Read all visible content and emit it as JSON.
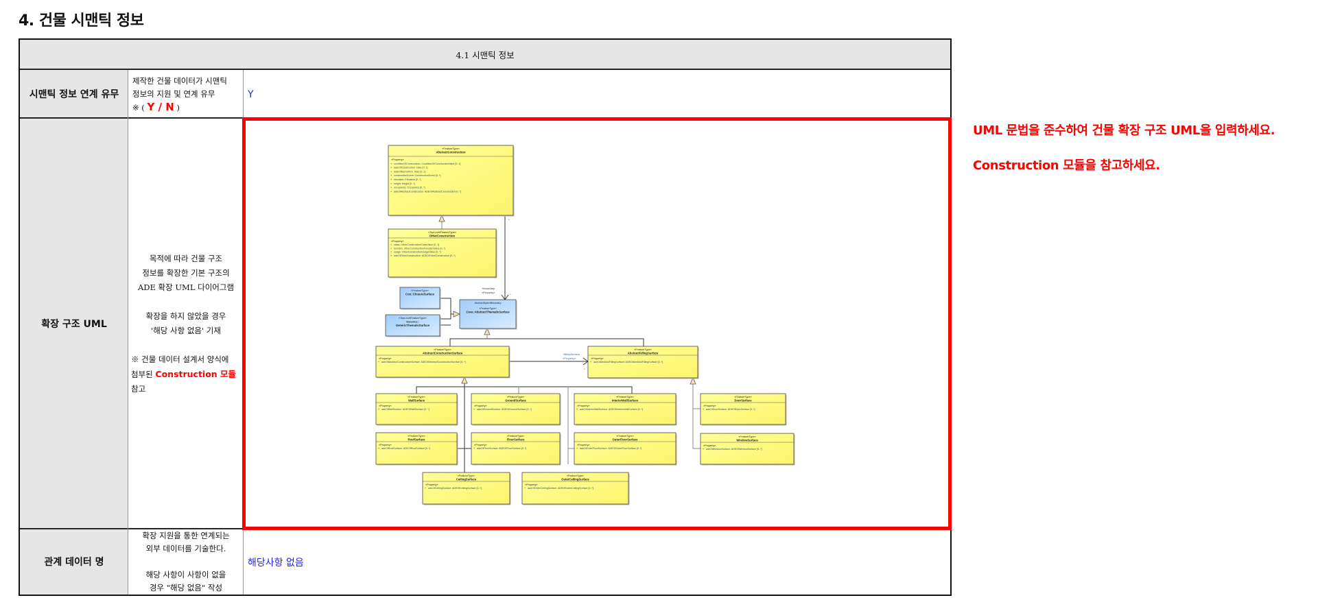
{
  "section_title": "4. 건물 시맨틱 정보",
  "table": {
    "header": "4.1 시맨틱 정보",
    "rows": [
      {
        "label": "시맨틱 정보 연계 유무",
        "description_lines": [
          "제작한 건물 데이터가 시맨틱",
          "정보의 지원 및 연계 유무"
        ],
        "yn_prefix": "※ (",
        "yn_options": "Y / N",
        "yn_suffix": ")",
        "value": "Y"
      },
      {
        "label": "확장 구조 UML",
        "description_lines": [
          "목적에 따라 건물 구조",
          "정보를 확장한 기본 구조의",
          "ADE 확장 UML 다이어그램",
          "",
          "확장을 하지 않았을 경우",
          "'해당 사항 없음' 기재",
          "",
          "※ 건물 데이터 설계서 양식에"
        ],
        "ref_prefix": "첨부된",
        "ref_highlight": "Construction 모듈",
        "ref_suffix": "참고"
      },
      {
        "label": "관계 데이터 명",
        "description_lines": [
          "확장 지원을 통한 연계되는",
          "외부 데이터를 기술한다.",
          "",
          "해당 사항이 사항이 없을",
          "경우 \"해당 없음\" 작성"
        ],
        "value": "해당사항 없음"
      }
    ]
  },
  "notes": [
    "UML 문법을 준수하여 건물 확장 구조 UML을 입력하세요.",
    "Construction 모듈을 참고하세요."
  ],
  "colors": {
    "accent_red": "#ff0000",
    "value_blue": "#2222ee",
    "class_yellow": "#ffff99",
    "class_blue": "#bcdcff"
  },
  "uml": {
    "classes": [
      {
        "stereotype": "«FeatureType»",
        "name": "AbstractConstruction",
        "abstract": true,
        "color": "yellow",
        "attributes": [
          "conditionOfConstruction: ConditionOfConstructionValue [0..1]",
          "dateOfConstruction: Date [0..1]",
          "dateOfDemolition: Date [0..1]",
          "constructionEvent: ConstructionEvent [0..*]",
          "elevation: Elevation [0..*]",
          "height: Height [0..*]",
          "occupancy: Occupancy [0..*]",
          "adeOfAbstractConstruction: ADEOfAbstractConstruction [0..*]"
        ]
      },
      {
        "stereotype": "«TopLevelFeatureType»",
        "name": "OtherConstruction",
        "color": "yellow",
        "attributes": [
          "class: OtherConstructionClassValue [0..1]",
          "function: OtherConstructionFunctionValue [0..*]",
          "usage: OtherConstructionUsageValue [0..*]",
          "adeOfOtherConstruction: ADEOfOtherConstruction [0..*]"
        ]
      },
      {
        "stereotype": "«FeatureType»",
        "name": "Con::ClosureSurface",
        "color": "blue",
        "attributes": []
      },
      {
        "stereotype": "«TopLevelFeatureType»",
        "package": "Generics::",
        "name": "GenericThematicSurface",
        "color": "blue",
        "attributes": []
      },
      {
        "package": "AbstractSpaceBoundary",
        "stereotype": "«FeatureType»",
        "name": "Core::AbstractThematicSurface",
        "abstract": true,
        "color": "blue",
        "attributes": []
      },
      {
        "stereotype": "«FeatureType»",
        "name": "AbstractConstructionSurface",
        "abstract": true,
        "color": "yellow",
        "attributes": [
          "adeOfAbstractConstructionSurface: ADEOfAbstractConstructionSurface [0..*]"
        ]
      },
      {
        "stereotype": "«FeatureType»",
        "name": "AbstractFillingSurface",
        "abstract": true,
        "color": "yellow",
        "attributes": [
          "adeOfAbstractFillingSurface: ADEOfAbstractFillingSurface [0..*]"
        ]
      },
      {
        "stereotype": "«FeatureType»",
        "name": "WallSurface",
        "color": "yellow",
        "attributes": [
          "adeOfWallSurface: ADEOfWallSurface [0..*]"
        ]
      },
      {
        "stereotype": "«FeatureType»",
        "name": "GroundSurface",
        "color": "yellow",
        "attributes": [
          "adeOfGroundSurface: ADEOfGroundSurface [0..*]"
        ]
      },
      {
        "stereotype": "«FeatureType»",
        "name": "InteriorWallSurface",
        "color": "yellow",
        "attributes": [
          "adeOfInteriorWallSurface: ADEOfInteriorWallSurface [0..*]"
        ]
      },
      {
        "stereotype": "«FeatureType»",
        "name": "DoorSurface",
        "color": "yellow",
        "attributes": [
          "adeOfDoorSurface: ADEOfDoorSurface [0..*]"
        ]
      },
      {
        "stereotype": "«FeatureType»",
        "name": "RoofSurface",
        "color": "yellow",
        "attributes": [
          "adeOfRoofSurface: ADEOfRoofSurface [0..*]"
        ]
      },
      {
        "stereotype": "«FeatureType»",
        "name": "FloorSurface",
        "color": "yellow",
        "attributes": [
          "adeOfFloorSurface: ADEOfFloorSurface [0..*]"
        ]
      },
      {
        "stereotype": "«FeatureType»",
        "name": "OuterFloorSurface",
        "color": "yellow",
        "attributes": [
          "adeOfOuterFloorSurface: ADEOfOuterFloorSurface [0..*]"
        ]
      },
      {
        "stereotype": "«FeatureType»",
        "name": "WindowSurface",
        "color": "yellow",
        "attributes": [
          "adeOfWindowSurface: ADEOfWindowSurface [0..*]"
        ]
      },
      {
        "stereotype": "«FeatureType»",
        "name": "CeilingSurface",
        "color": "yellow",
        "attributes": [
          "adeOfCeilingSurface: ADEOfCeilingSurface [0..*]"
        ]
      },
      {
        "stereotype": "«FeatureType»",
        "name": "OuterCeilingSurface",
        "color": "yellow",
        "attributes": [
          "adeOfOuterCeilingSurface: ADEOfOuterCeilingSurface [0..*]"
        ]
      }
    ],
    "property_stereotype": "«Property»",
    "associations": [
      {
        "role": "+boundary",
        "stereotype": "«Property»",
        "multiplicity": "*"
      },
      {
        "role": "+fillingSurface",
        "stereotype": "«Property»",
        "multiplicity": "*"
      }
    ]
  }
}
